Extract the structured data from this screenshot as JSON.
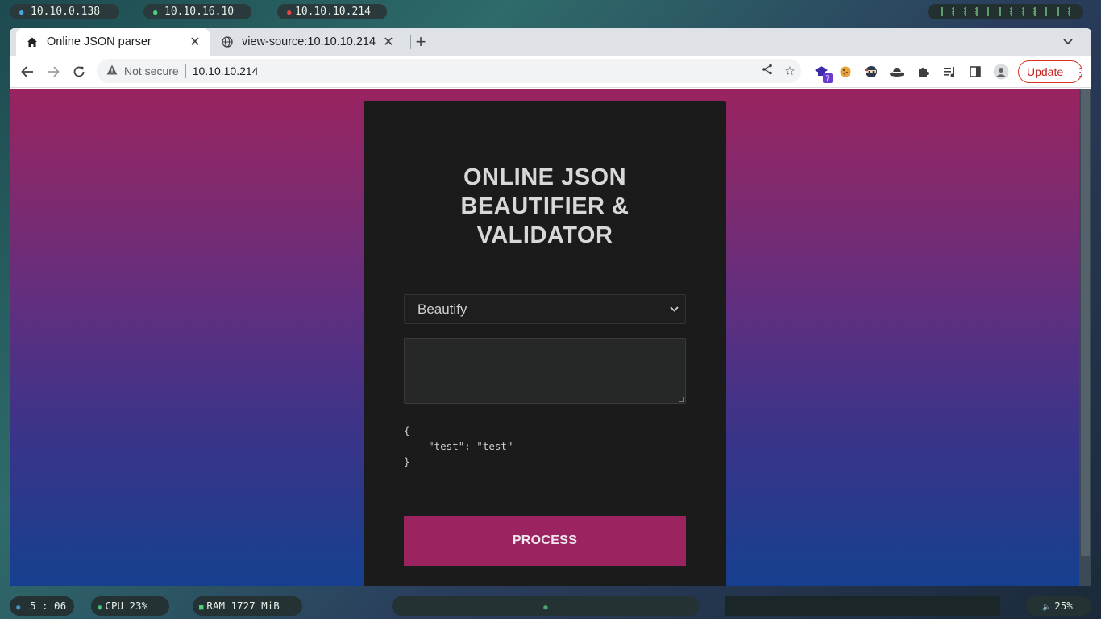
{
  "topbar": {
    "hosts": [
      {
        "label": "10.10.0.138",
        "dot_color": "#4aa8d8"
      },
      {
        "label": "10.10.16.10",
        "dot_color": "#4cd17a"
      },
      {
        "label": "10.10.10.214",
        "dot_color": "#e04848"
      }
    ],
    "workspace_count": 12
  },
  "browser": {
    "tabs": [
      {
        "label": "Online JSON parser",
        "icon": "home-icon",
        "active": true
      },
      {
        "label": "view-source:10.10.10.214",
        "icon": "globe-icon",
        "active": false
      }
    ],
    "new_tab_label": "+",
    "omnibox": {
      "security_label": "Not secure",
      "url": "10.10.10.214"
    },
    "extensions": [
      {
        "name": "extension-hat-icon",
        "badge": "7"
      },
      {
        "name": "extension-cookie-icon"
      },
      {
        "name": "extension-ninja-icon"
      },
      {
        "name": "extension-hat2-icon"
      },
      {
        "name": "extensions-puzzle-icon"
      },
      {
        "name": "media-queue-icon"
      },
      {
        "name": "side-panel-icon"
      },
      {
        "name": "profile-icon"
      }
    ],
    "update_label": "Update"
  },
  "page": {
    "title": "ONLINE JSON BEAUTIFIER & VALIDATOR",
    "title_lines": [
      "ONLINE JSON",
      "BEAUTIFIER &",
      "VALIDATOR"
    ],
    "mode_select": {
      "value": "Beautify"
    },
    "input_text": "",
    "output_text": "{\n    \"test\": \"test\"\n}",
    "process_label": "PROCESS",
    "colors": {
      "card": "#1b1b1b",
      "button": "#9b2360",
      "title": "#d8d8d8"
    }
  },
  "bottombar": {
    "clock": "5 : 06",
    "cpu": "CPU 23%",
    "ram": "RAM 1727 MiB",
    "volume": "25%"
  }
}
